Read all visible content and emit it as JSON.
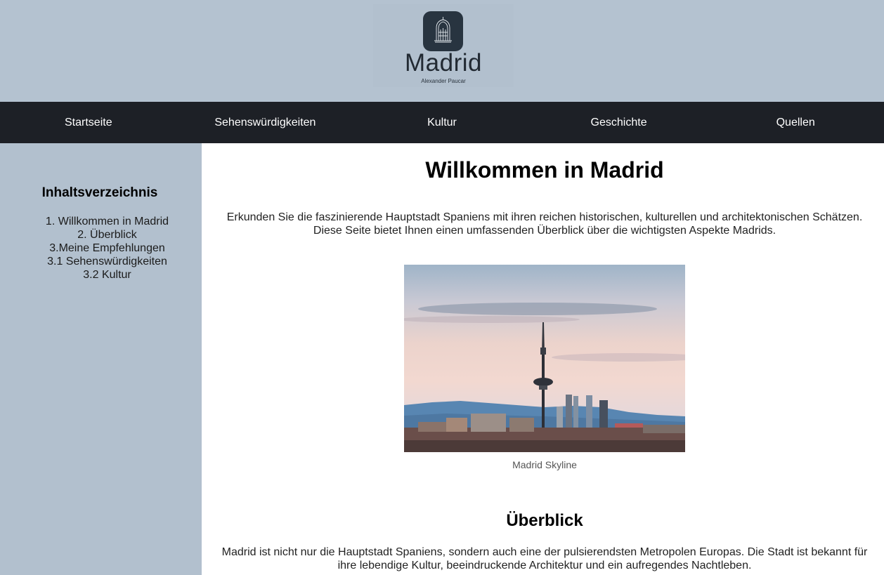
{
  "header": {
    "logo_title": "Madrid",
    "logo_subtitle": "Alexander Paucar",
    "colors": {
      "background": "#b4c2d0",
      "tile": "#283440"
    },
    "logo_icon": "building-icon"
  },
  "nav": {
    "items": [
      {
        "label": "Startseite"
      },
      {
        "label": "Sehenswürdigkeiten"
      },
      {
        "label": "Kultur"
      },
      {
        "label": "Geschichte"
      },
      {
        "label": "Quellen"
      }
    ],
    "color": "#1d2026"
  },
  "sidebar": {
    "title": "Inhaltsverzeichnis",
    "items": [
      {
        "label": "1. Willkommen in Madrid"
      },
      {
        "label": "2. Überblick"
      },
      {
        "label": "3.Meine Empfehlungen"
      },
      {
        "label": "3.1 Sehenswürdigkeiten"
      },
      {
        "label": "3.2 Kultur"
      }
    ],
    "color": "#b2c0ce"
  },
  "main": {
    "title": "Willkommen in Madrid",
    "intro": "Erkunden Sie die faszinierende Hauptstadt Spaniens mit ihren reichen historischen, kulturellen und architektonischen Schätzen. Diese Seite bietet Ihnen einen umfassenden Überblick über die wichtigsten Aspekte Madrids.",
    "image_caption": "Madrid Skyline",
    "overview_title": "Überblick",
    "overview_text": "Madrid ist nicht nur die Hauptstadt Spaniens, sondern auch eine der pulsierendsten Metropolen Europas. Die Stadt ist bekannt für ihre lebendige Kultur, beeindruckende Architektur und ein aufregendes Nachtleben."
  }
}
